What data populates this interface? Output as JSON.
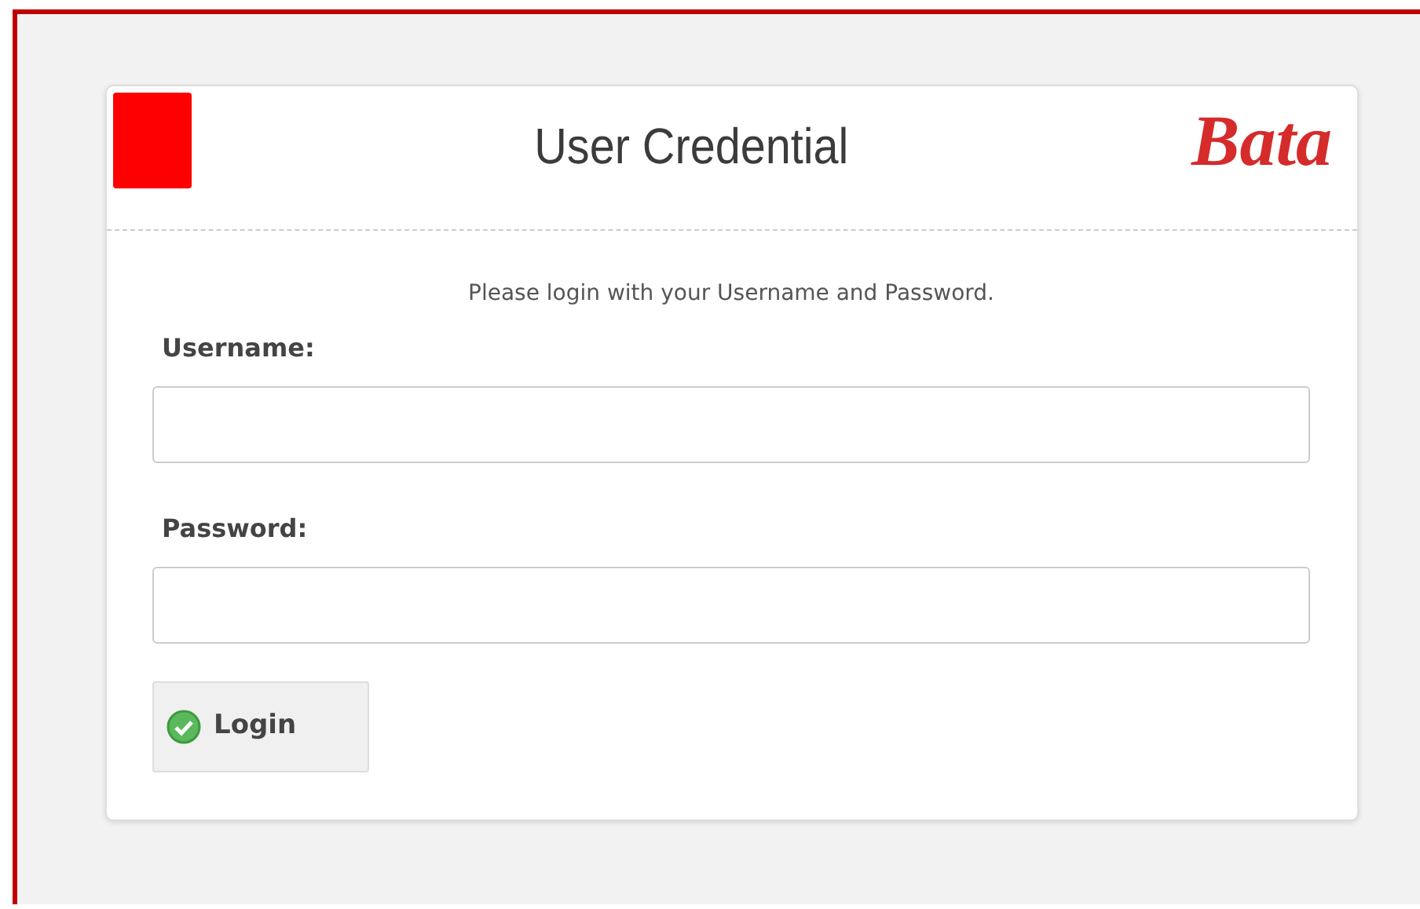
{
  "header": {
    "title": "User Credential",
    "logo": "Bata"
  },
  "intro": "Please login with your Username and Password.",
  "fields": [
    {
      "label": "Username:"
    },
    {
      "label": "Password:"
    }
  ],
  "button": {
    "label": "Login"
  }
}
